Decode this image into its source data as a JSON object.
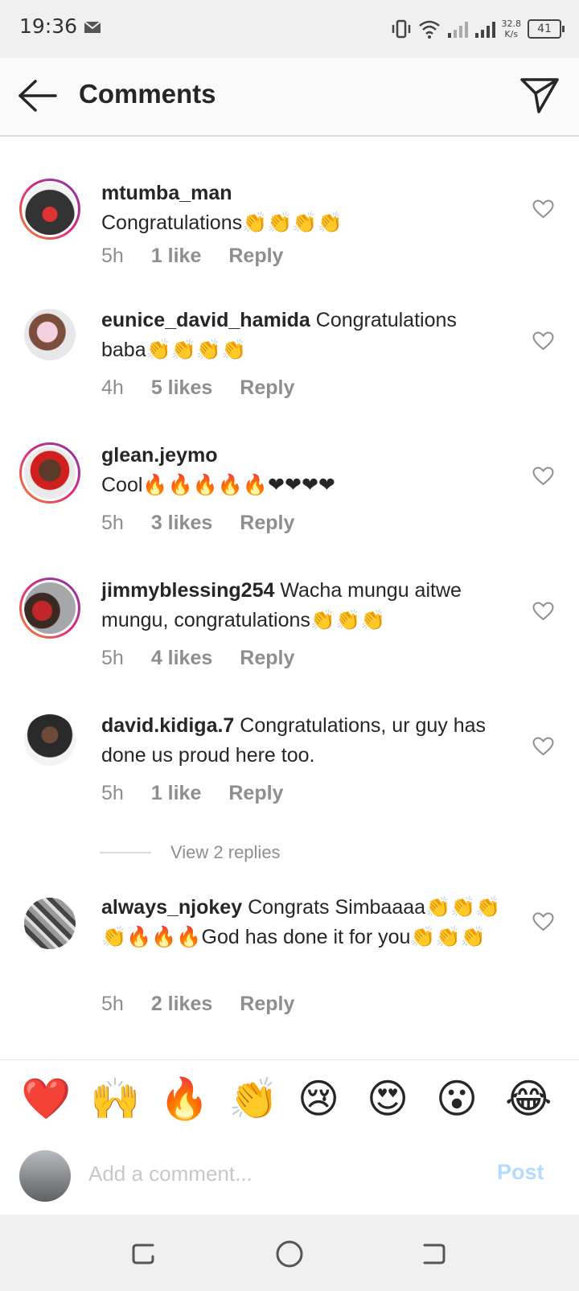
{
  "status_bar": {
    "time": "19:36",
    "speed_value": "32.8",
    "speed_unit": "K/s",
    "battery": "41"
  },
  "header": {
    "title": "Comments"
  },
  "comments": [
    {
      "username": "mtumba_man",
      "text": "Congratulations👏👏👏👏",
      "time": "5h",
      "likes": "1 like",
      "reply": "Reply"
    },
    {
      "username": "eunice_david_hamida",
      "text": "Congratulations baba👏👏👏👏",
      "time": "4h",
      "likes": "5 likes",
      "reply": "Reply"
    },
    {
      "username": "glean.jeymo",
      "text": "Cool🔥🔥🔥🔥🔥❤❤❤❤",
      "time": "5h",
      "likes": "3 likes",
      "reply": "Reply"
    },
    {
      "username": "jimmyblessing254",
      "text": "Wacha mungu aitwe mungu, congratulations👏👏👏",
      "time": "5h",
      "likes": "4 likes",
      "reply": "Reply"
    },
    {
      "username": "david.kidiga.7",
      "text": "Congratulations, ur guy has done us proud here too.",
      "time": "5h",
      "likes": "1 like",
      "reply": "Reply"
    },
    {
      "username": "always_njokey",
      "text": "Congrats Simbaaaa👏👏👏👏🔥🔥🔥God has done it for you👏👏👏",
      "time": "5h",
      "likes": "2 likes",
      "reply": "Reply"
    }
  ],
  "view_replies": "View 2 replies",
  "emoji_bar": [
    "❤️",
    "🙌",
    "🔥",
    "👏",
    "😢",
    "😍",
    "😮",
    "😂"
  ],
  "add_comment": {
    "placeholder": "Add a comment...",
    "post_label": "Post"
  },
  "colors": {
    "accent_post": "#b3dbff",
    "secondary_text": "#8e8e8e",
    "primary_text": "#262626"
  }
}
